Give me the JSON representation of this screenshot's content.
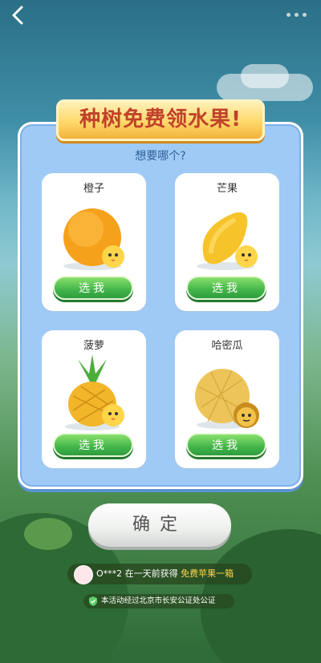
{
  "topbar": {
    "back_icon": "chevron-left-icon",
    "more_icon": "more-dots-icon"
  },
  "banner": {
    "title": "种树免费领水果!"
  },
  "panel": {
    "question": "想要哪个?"
  },
  "options": [
    {
      "name": "橙子",
      "button": "选我"
    },
    {
      "name": "芒果",
      "button": "选我"
    },
    {
      "name": "菠萝",
      "button": "选我"
    },
    {
      "name": "哈密瓜",
      "button": "选我"
    }
  ],
  "confirm": {
    "label": "确定"
  },
  "notice": {
    "user": "O***2",
    "text": "在一天前获得",
    "highlight": "免费苹果一箱"
  },
  "certification": {
    "text": "本活动经过北京市长安公证处公证"
  },
  "colors": {
    "accent_green": "#42b54a",
    "banner_text": "#c0412a",
    "panel_blue": "#9fcaf6"
  }
}
